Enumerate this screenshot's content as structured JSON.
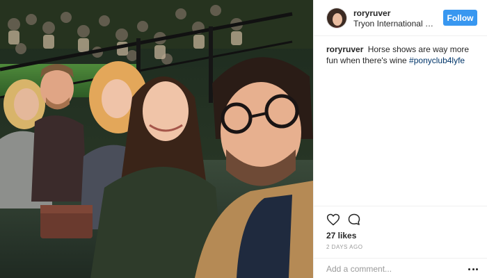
{
  "post": {
    "image_alt": "Selfie of five friends in stadium seating at a horse show at night",
    "header": {
      "username": "roryruver",
      "location": "Tryon International E...",
      "follow_label": "Follow"
    },
    "caption": {
      "username": "roryruver",
      "text": "Horse shows are way more fun when there's wine",
      "hashtag": "#ponyclub4lyfe"
    },
    "actions": {
      "like_icon": "heart-icon",
      "comment_icon": "comment-icon"
    },
    "likes": "27 likes",
    "timestamp": "2 DAYS AGO",
    "add_comment_placeholder": "Add a comment...",
    "more_icon": "ellipsis-icon"
  },
  "colors": {
    "accent": "#3897f0",
    "hashtag": "#003569",
    "muted": "#999999",
    "border": "#efefef",
    "text": "#262626"
  }
}
